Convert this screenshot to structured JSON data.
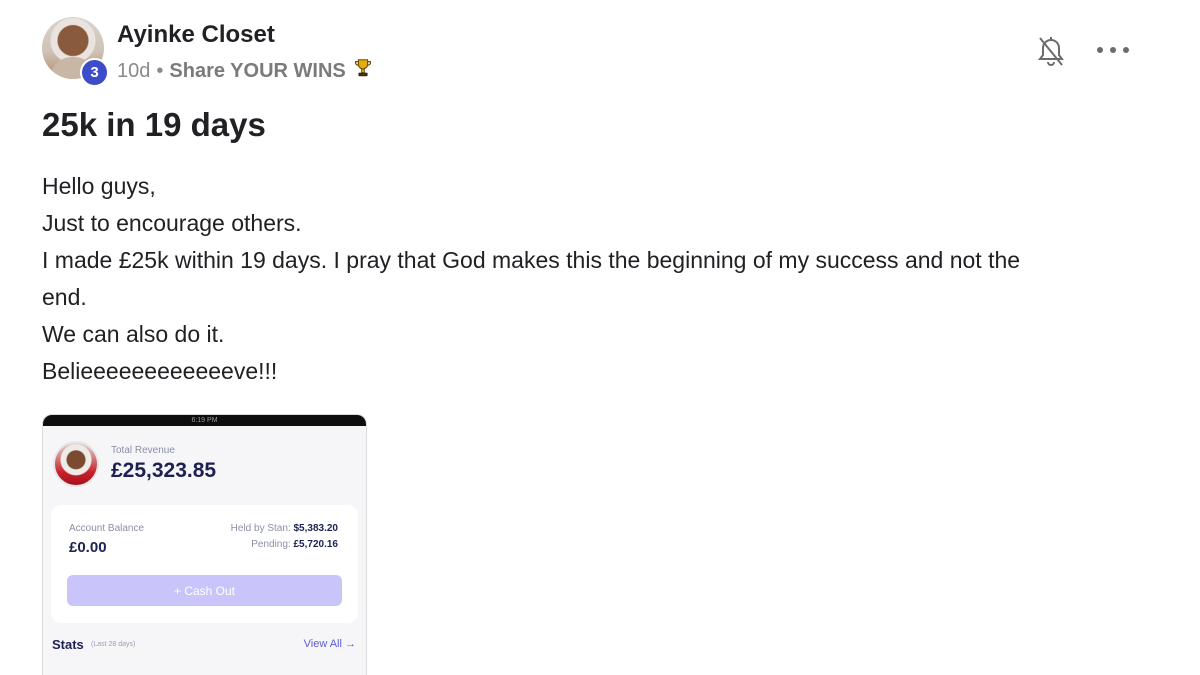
{
  "post": {
    "author": "Ayinke Closet",
    "level": "3",
    "time_ago": "10d",
    "separator": "•",
    "category": "Share YOUR WINS",
    "category_icon": "trophy-icon",
    "title": "25k in 19 days",
    "body_lines": [
      "Hello guys,",
      "Just to encourage others.",
      "I made £25k within 19 days. I pray that God makes this the beginning of my success and not the",
      "end.",
      "We can also do it.",
      "Belieeeeeeeeeeeeve!!!"
    ]
  },
  "actions": {
    "notify_icon": "bell-off-icon",
    "more_icon": "more-horizontal-icon"
  },
  "attachment": {
    "status_time": "6:19 PM",
    "total_revenue_label": "Total Revenue",
    "total_revenue_value": "£25,323.85",
    "account_balance_label": "Account Balance",
    "account_balance_value": "£0.00",
    "held_label": "Held by Stan:",
    "held_value": "$5,383.20",
    "pending_label": "Pending:",
    "pending_value": "£5,720.16",
    "cashout_label": "+ Cash Out",
    "stats_title": "Stats",
    "stats_period": "(Last 28 days)",
    "view_all_label": "View All →"
  },
  "colors": {
    "level_badge": "#3d4dc9",
    "cashout_button": "#c9c5fb",
    "revenue_text": "#1d2152",
    "link": "#5a5bd6"
  }
}
